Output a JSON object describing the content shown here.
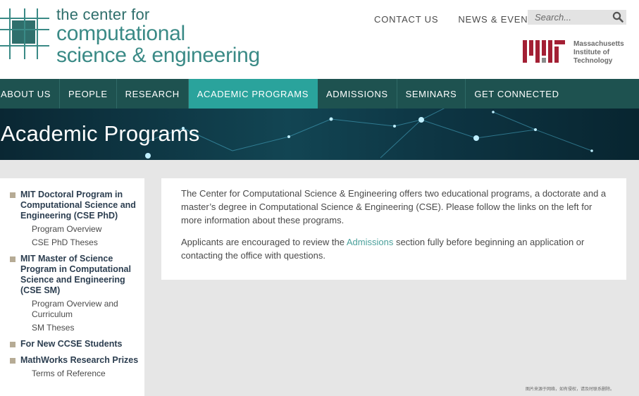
{
  "header": {
    "logo_line1": "the center for",
    "logo_line2": "computational",
    "logo_line3": "science & engineering",
    "utility_links": [
      "CONTACT US",
      "NEWS & EVENTS"
    ],
    "search_placeholder": "Search...",
    "mit_name": [
      "Massachusetts",
      "Institute of",
      "Technology"
    ]
  },
  "nav": {
    "items": [
      "ABOUT US",
      "PEOPLE",
      "RESEARCH",
      "ACADEMIC PROGRAMS",
      "ADMISSIONS",
      "SEMINARS",
      "GET CONNECTED"
    ],
    "active": "ACADEMIC PROGRAMS"
  },
  "banner": {
    "title": "Academic Programs"
  },
  "sidebar": {
    "groups": [
      {
        "title": "MIT Doctoral Program in Computational Science and Engineering (CSE PhD)",
        "subs": [
          "Program Overview",
          "CSE PhD Theses"
        ]
      },
      {
        "title": "MIT Master of Science Program in Computational Science and Engineering (CSE SM)",
        "subs": [
          "Program Overview and Curriculum",
          "SM Theses"
        ]
      },
      {
        "title": "For New CCSE Students",
        "subs": []
      },
      {
        "title": "MathWorks Research Prizes",
        "subs": [
          "Terms of Reference"
        ]
      }
    ]
  },
  "content": {
    "para1": "The Center for Computational Science & Engineering offers two educational programs, a doctorate and a master’s degree in Computational Science & Engineering (CSE). Please follow the links on the left for more information about these programs.",
    "para2_before": "Applicants are encouraged to review the ",
    "para2_link": "Admissions",
    "para2_after": " section fully before beginning an application or contacting the office with questions."
  },
  "watermark": "图片来源于网络，如有侵权，请及时联系删除。",
  "colors": {
    "nav_bg": "#1e5250",
    "nav_active": "#2aa39c",
    "logo_teal": "#3a8a86",
    "mit_red": "#a31f34",
    "bullet": "#b6ab95",
    "link": "#4aa09b"
  },
  "icons": {
    "search": "search-icon",
    "logo": "grid-logo-icon",
    "mit": "mit-logo-icon"
  }
}
